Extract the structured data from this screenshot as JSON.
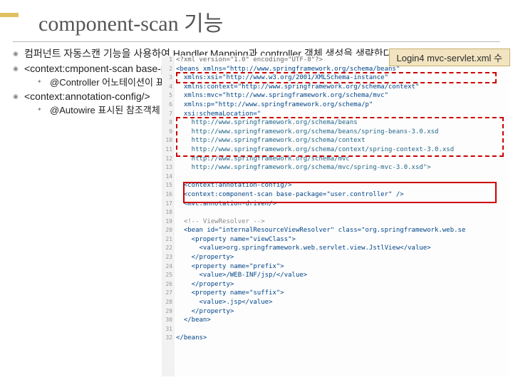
{
  "title": "component-scan 기능",
  "bullets": [
    {
      "text": "컴퍼넌트 자동스캔 기능을 사용하여 Handler.Mapping과 controller 객체 생성을 생략한다.",
      "sub": []
    },
    {
      "text": "<context:cmponent-scan base-package=\"user.controller\" />",
      "sub": [
        "@Controller 어노테이션이 표기된 Controller 자동 검색 객체(빈) 생성"
      ]
    },
    {
      "text": "<context:annotation-config/>",
      "sub": [
        "@Autowire 표시된 참조객체 자동 DI"
      ]
    }
  ],
  "callout": "Login4 mvc-servlet.xml 수",
  "code": {
    "lines": [
      {
        "n": 1,
        "cls": "t-pi",
        "txt": "<?xml version=\"1.0\" encoding=\"UTF-8\"?>"
      },
      {
        "n": 2,
        "cls": "t-tag",
        "txt": "<beans xmlns=\"http://www.springframework.org/schema/beans\""
      },
      {
        "n": 3,
        "cls": "t-ns",
        "txt": "  xmlns:xsi=\"http://www.w3.org/2001/XMLSchema-instance\""
      },
      {
        "n": 4,
        "cls": "t-ns",
        "txt": "  xmlns:context=\"http://www.springframework.org/schema/context\""
      },
      {
        "n": 5,
        "cls": "t-ns",
        "txt": "  xmlns:mvc=\"http://www.springframework.org/schema/mvc\""
      },
      {
        "n": 6,
        "cls": "t-ns",
        "txt": "  xmlns:p=\"http://www.springframework.org/schema/p\""
      },
      {
        "n": 7,
        "cls": "t-ns",
        "txt": "  xsi:schemaLocation=\""
      },
      {
        "n": 8,
        "cls": "t-str",
        "txt": "    http://www.springframework.org/schema/beans"
      },
      {
        "n": 9,
        "cls": "t-str",
        "txt": "    http://www.springframework.org/schema/beans/spring-beans-3.0.xsd"
      },
      {
        "n": 10,
        "cls": "t-str",
        "txt": "    http://www.springframework.org/schema/context"
      },
      {
        "n": 11,
        "cls": "t-str",
        "txt": "    http://www.springframework.org/schema/context/spring-context-3.0.xsd"
      },
      {
        "n": 12,
        "cls": "t-str",
        "txt": "    http://www.springframework.org/schema/mvc"
      },
      {
        "n": 13,
        "cls": "t-str",
        "txt": "    http://www.springframework.org/schema/mvc/spring-mvc-3.0.xsd\">"
      },
      {
        "n": 14,
        "cls": "",
        "txt": ""
      },
      {
        "n": 15,
        "cls": "t-tag",
        "txt": "  <context:annotation-config/>"
      },
      {
        "n": 16,
        "cls": "t-tag",
        "txt": "  <context:component-scan base-package=\"user.controller\" />"
      },
      {
        "n": 17,
        "cls": "t-tag",
        "txt": "  <mvc:annotation-driven/>"
      },
      {
        "n": 18,
        "cls": "",
        "txt": ""
      },
      {
        "n": 19,
        "cls": "t-cm",
        "txt": "  <!-- ViewResolver -->"
      },
      {
        "n": 20,
        "cls": "t-tag",
        "txt": "  <bean id=\"internalResourceViewResolver\" class=\"org.springframework.web.se"
      },
      {
        "n": 21,
        "cls": "t-tag",
        "txt": "    <property name=\"viewClass\">"
      },
      {
        "n": 22,
        "cls": "t-tag",
        "txt": "      <value>org.springframework.web.servlet.view.JstlView</value>"
      },
      {
        "n": 23,
        "cls": "t-tag",
        "txt": "    </property>"
      },
      {
        "n": 24,
        "cls": "t-tag",
        "txt": "    <property name=\"prefix\">"
      },
      {
        "n": 25,
        "cls": "t-tag",
        "txt": "      <value>/WEB-INF/jsp/</value>"
      },
      {
        "n": 26,
        "cls": "t-tag",
        "txt": "    </property>"
      },
      {
        "n": 27,
        "cls": "t-tag",
        "txt": "    <property name=\"suffix\">"
      },
      {
        "n": 28,
        "cls": "t-tag",
        "txt": "      <value>.jsp</value>"
      },
      {
        "n": 29,
        "cls": "t-tag",
        "txt": "    </property>"
      },
      {
        "n": 30,
        "cls": "t-tag",
        "txt": "  </bean>"
      },
      {
        "n": 31,
        "cls": "",
        "txt": ""
      },
      {
        "n": 32,
        "cls": "t-tag",
        "txt": "</beans>"
      }
    ]
  }
}
